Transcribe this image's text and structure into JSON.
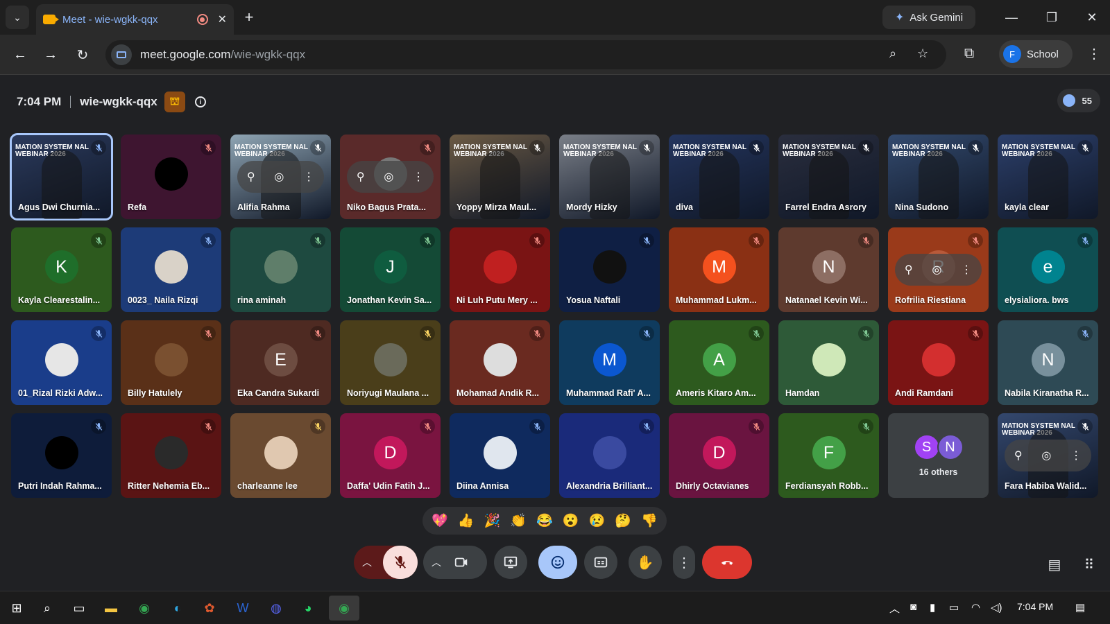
{
  "browser": {
    "tab_title": "Meet - wie-wgkk-qqx",
    "ask_gemini": "Ask Gemini",
    "url_host": "meet.google.com",
    "url_path": "/wie-wgkk-qqx",
    "profile_initial": "F",
    "profile_name": "School"
  },
  "meeting": {
    "time": "7:04 PM",
    "code": "wie-wgkk-qqx",
    "participant_count": "55"
  },
  "tiles": [
    {
      "name": "Agus Dwi Churnia...",
      "type": "video",
      "bg": "#2b3a5c",
      "mic": "#8ab4f8",
      "selected": true
    },
    {
      "name": "Refa",
      "type": "avatar",
      "bg": "#3e1530",
      "avatar_bg": "#000000",
      "letter": "",
      "mic": "#f28b82"
    },
    {
      "name": "Alifia Rahma",
      "type": "video",
      "bg": "#8fa5b4",
      "mic": "#ffffff",
      "hover": true
    },
    {
      "name": "Niko Bagus Prata...",
      "type": "avatar",
      "bg": "#5a2a2a",
      "avatar_bg": "#777777",
      "letter": "",
      "mic": "#f28b82",
      "hover": true
    },
    {
      "name": "Yoppy Mirza Maul...",
      "type": "video",
      "bg": "#6b5a44",
      "mic": "#ffffff"
    },
    {
      "name": "Mordy Hizky",
      "type": "video",
      "bg": "#7a7f88",
      "mic": "#ffffff"
    },
    {
      "name": "diva",
      "type": "video",
      "bg": "#24355e",
      "mic": "#ffffff"
    },
    {
      "name": "Farrel Endra Asrory",
      "type": "video",
      "bg": "#2a2e3e",
      "mic": "#ffffff"
    },
    {
      "name": "Nina Sudono",
      "type": "video",
      "bg": "#334a6e",
      "mic": "#ffffff"
    },
    {
      "name": "kayla clear",
      "type": "video",
      "bg": "#2c3f6a",
      "mic": "#ffffff"
    },
    {
      "name": "Kayla Clearestalin...",
      "type": "avatar",
      "bg": "#2d5a1e",
      "avatar_bg": "#1f6e2a",
      "letter": "K",
      "mic": "#81c995"
    },
    {
      "name": "0023_ Naila Rizqi",
      "type": "avatar",
      "bg": "#1d3b78",
      "avatar_bg": "#d9d2c8",
      "letter": "",
      "mic": "#8ab4f8"
    },
    {
      "name": "rina aminah",
      "type": "avatar",
      "bg": "#1e4a40",
      "avatar_bg": "#5f7e6a",
      "letter": "",
      "mic": "#81c995"
    },
    {
      "name": "Jonathan Kevin Sa...",
      "type": "avatar",
      "bg": "#144a36",
      "avatar_bg": "#0f5c3f",
      "letter": "J",
      "mic": "#81c995"
    },
    {
      "name": "Ni Luh Putu Mery ...",
      "type": "avatar",
      "bg": "#7a1414",
      "avatar_bg": "#c02020",
      "letter": "",
      "mic": "#f28b82"
    },
    {
      "name": "Yosua Naftali",
      "type": "avatar",
      "bg": "#0f1f44",
      "avatar_bg": "#111111",
      "letter": "",
      "mic": "#8ab4f8"
    },
    {
      "name": "Muhammad Lukm...",
      "type": "avatar",
      "bg": "#8a3014",
      "avatar_bg": "#f4511e",
      "letter": "M",
      "mic": "#f28b82"
    },
    {
      "name": "Natanael Kevin Wi...",
      "type": "avatar",
      "bg": "#5e3a2e",
      "avatar_bg": "#8d6e63",
      "letter": "N",
      "mic": "#f28b82"
    },
    {
      "name": "Rofrilia Riestiana",
      "type": "avatar",
      "bg": "#9a3a1a",
      "avatar_bg": "#b85a3a",
      "letter": "R",
      "mic": "#f28b82",
      "hover": true
    },
    {
      "name": "elysialiora. bws",
      "type": "avatar",
      "bg": "#0f4e52",
      "avatar_bg": "#00838f",
      "letter": "e",
      "mic": "#8ab4f8"
    },
    {
      "name": "01_Rizal Rizki Adw...",
      "type": "avatar",
      "bg": "#1a3d8a",
      "avatar_bg": "#e6e6e6",
      "letter": "",
      "mic": "#8ab4f8"
    },
    {
      "name": "Billy Hatulely",
      "type": "avatar",
      "bg": "#5a3018",
      "avatar_bg": "#7a5030",
      "letter": "",
      "mic": "#f28b82"
    },
    {
      "name": "Eka Candra Sukardi",
      "type": "avatar",
      "bg": "#4e2a22",
      "avatar_bg": "#6d4c41",
      "letter": "E",
      "mic": "#f28b82"
    },
    {
      "name": "Noriyugi Maulana ...",
      "type": "avatar",
      "bg": "#4a3e1a",
      "avatar_bg": "#6a6a5a",
      "letter": "",
      "mic": "#fdd663"
    },
    {
      "name": "Mohamad Andik R...",
      "type": "avatar",
      "bg": "#6a2a20",
      "avatar_bg": "#dddddd",
      "letter": "",
      "mic": "#f28b82"
    },
    {
      "name": "Muhammad Rafi' A...",
      "type": "avatar",
      "bg": "#0f3b5e",
      "avatar_bg": "#0b57d0",
      "letter": "M",
      "mic": "#8ab4f8"
    },
    {
      "name": "Ameris Kitaro Am...",
      "type": "avatar",
      "bg": "#2d5a1e",
      "avatar_bg": "#43a047",
      "letter": "A",
      "mic": "#81c995"
    },
    {
      "name": "Hamdan",
      "type": "avatar",
      "bg": "#2e5a38",
      "avatar_bg": "#cfe8b8",
      "letter": "",
      "mic": "#81c995"
    },
    {
      "name": "Andi Ramdani",
      "type": "avatar",
      "bg": "#7a1414",
      "avatar_bg": "#d32f2f",
      "letter": "",
      "mic": "#f28b82"
    },
    {
      "name": "Nabila Kiranatha R...",
      "type": "avatar",
      "bg": "#2e4a55",
      "avatar_bg": "#78909c",
      "letter": "N",
      "mic": "#8ab4f8"
    },
    {
      "name": "Putri Indah Rahma...",
      "type": "avatar",
      "bg": "#0e1c3a",
      "avatar_bg": "#000000",
      "letter": "",
      "mic": "#8ab4f8"
    },
    {
      "name": "Ritter Nehemia Eb...",
      "type": "avatar",
      "bg": "#5a1414",
      "avatar_bg": "#2a2a2a",
      "letter": "",
      "mic": "#f28b82"
    },
    {
      "name": "charleanne lee",
      "type": "avatar",
      "bg": "#6a4a30",
      "avatar_bg": "#e0c8b0",
      "letter": "",
      "mic": "#fdd663"
    },
    {
      "name": "Daffa' Udin Fatih J...",
      "type": "avatar",
      "bg": "#7a1440",
      "avatar_bg": "#c2185b",
      "letter": "D",
      "mic": "#f28b82"
    },
    {
      "name": "Diina Annisa",
      "type": "avatar",
      "bg": "#0f2a5e",
      "avatar_bg": "#e0e6ee",
      "letter": "",
      "mic": "#8ab4f8"
    },
    {
      "name": "Alexandria Brilliant...",
      "type": "avatar",
      "bg": "#1a2a7a",
      "avatar_bg": "#3a4aa0",
      "letter": "",
      "mic": "#8ab4f8"
    },
    {
      "name": "Dhirly Octavianes",
      "type": "avatar",
      "bg": "#6a1440",
      "avatar_bg": "#c2185b",
      "letter": "D",
      "mic": "#f28b82"
    },
    {
      "name": "Ferdiansyah Robb...",
      "type": "avatar",
      "bg": "#2d5a1e",
      "avatar_bg": "#43a047",
      "letter": "F",
      "mic": "#81c995"
    },
    {
      "name": "16 others",
      "type": "others",
      "bg": "#3c4043",
      "letters": [
        "S",
        "N"
      ],
      "mic": ""
    },
    {
      "name": "Fara Habiba Walid...",
      "type": "video",
      "bg": "#34486e",
      "mic": "#ffffff",
      "hover": true
    }
  ],
  "webinar_text": "MATION SYSTEM NAL WEBINAR 2026",
  "reactions": [
    "💖",
    "👍",
    "🎉",
    "👏",
    "😂",
    "😮",
    "😢",
    "🤔",
    "👎"
  ],
  "taskbar": {
    "time": "7:04 PM"
  }
}
